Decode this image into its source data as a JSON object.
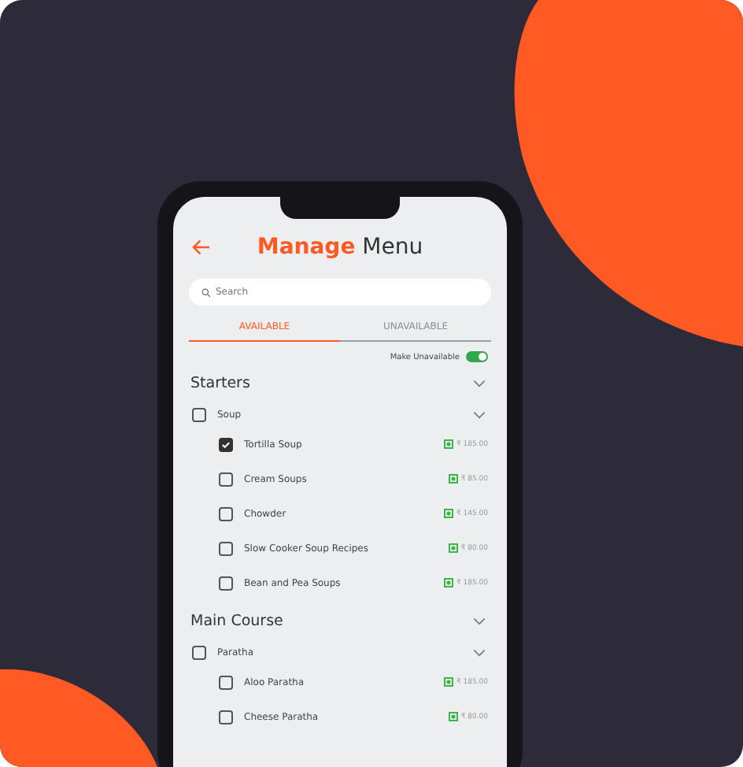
{
  "header": {
    "title_highlight": "Manage",
    "title_rest": "Menu"
  },
  "search": {
    "placeholder": "Search"
  },
  "tabs": [
    {
      "label": "AVAILABLE",
      "selected": true
    },
    {
      "label": "UNAVAILABLE",
      "selected": false
    }
  ],
  "toggle": {
    "label": "Make Unavailable",
    "on": true
  },
  "sections": [
    {
      "name": "Starters",
      "groups": [
        {
          "name": "Soup",
          "checked": false,
          "items": [
            {
              "name": "Tortilla Soup",
              "checked": true,
              "price": "₹ 185.00"
            },
            {
              "name": "Cream Soups",
              "checked": false,
              "price": "₹ 85.00"
            },
            {
              "name": "Chowder",
              "checked": false,
              "price": "₹ 145.00"
            },
            {
              "name": "Slow Cooker Soup Recipes",
              "checked": false,
              "price": "₹ 80.00"
            },
            {
              "name": "Bean and Pea Soups",
              "checked": false,
              "price": "₹ 185.00"
            }
          ]
        }
      ]
    },
    {
      "name": "Main Course",
      "groups": [
        {
          "name": "Paratha",
          "checked": false,
          "items": [
            {
              "name": "Aloo Paratha",
              "checked": false,
              "price": "₹ 185.00"
            },
            {
              "name": "Cheese Paratha",
              "checked": false,
              "price": "₹ 80.00"
            }
          ]
        }
      ]
    }
  ]
}
